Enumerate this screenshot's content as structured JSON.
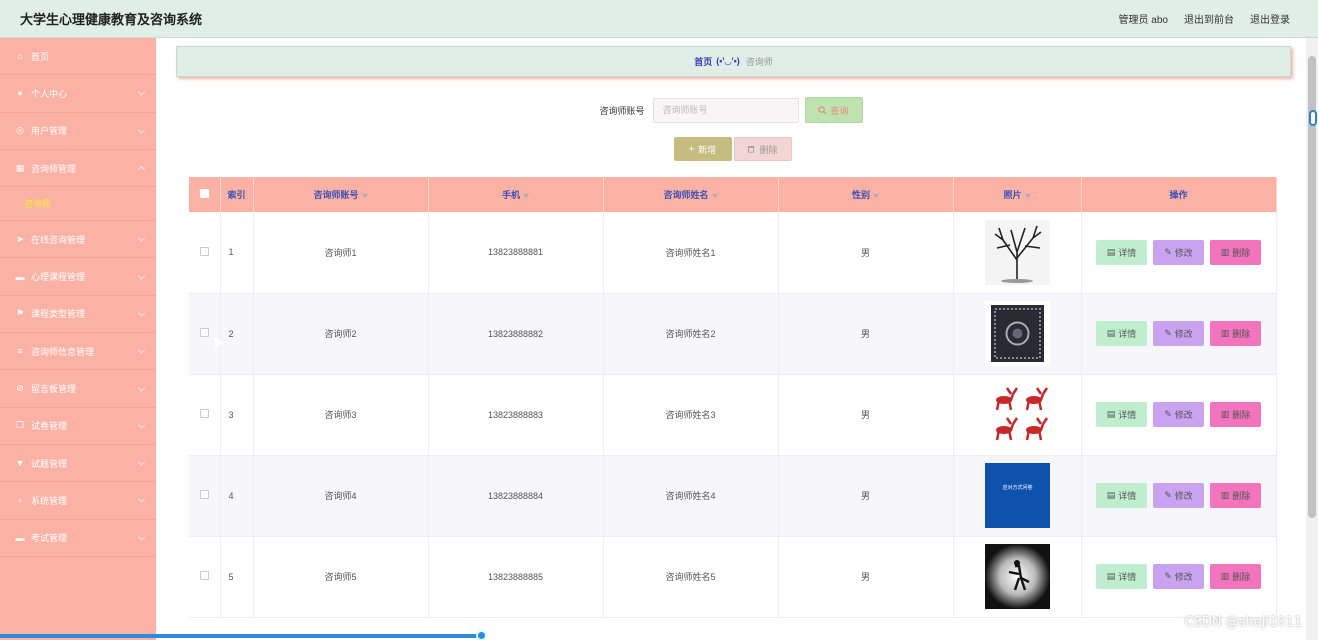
{
  "app": {
    "title": "大学生心理健康教育及咨询系统",
    "top_actions": [
      "管理员 abo",
      "退出到前台",
      "退出登录"
    ]
  },
  "sidebar": {
    "items": [
      {
        "label": "首页",
        "icon": "home-icon",
        "expandable": false
      },
      {
        "label": "个人中心",
        "icon": "user-icon",
        "expandable": true
      },
      {
        "label": "用户管理",
        "icon": "globe-icon",
        "expandable": true
      },
      {
        "label": "咨询师管理",
        "icon": "grid-icon",
        "expandable": true,
        "expanded": true
      },
      {
        "label": "在线咨询管理",
        "icon": "send-icon",
        "expandable": true
      },
      {
        "label": "心理课程管理",
        "icon": "truck-icon",
        "expandable": true
      },
      {
        "label": "课程类型管理",
        "icon": "flag-icon",
        "expandable": true
      },
      {
        "label": "咨询师信息管理",
        "icon": "menu-icon",
        "expandable": true
      },
      {
        "label": "留言板管理",
        "icon": "compass-icon",
        "expandable": true
      },
      {
        "label": "试卷管理",
        "icon": "copy-icon",
        "expandable": true
      },
      {
        "label": "试题管理",
        "icon": "trophy-icon",
        "expandable": true
      },
      {
        "label": "系统管理",
        "icon": "mic-icon",
        "expandable": true
      },
      {
        "label": "考试管理",
        "icon": "chat-icon",
        "expandable": true
      }
    ],
    "active_submenu": "咨询师"
  },
  "breadcrumb": {
    "home": "首页",
    "face": "(•'◡'•)",
    "current": "咨询师"
  },
  "search": {
    "label": "咨询师账号",
    "placeholder": "咨询师账号",
    "button": "查询"
  },
  "actions": {
    "add": "新增",
    "delete": "删除"
  },
  "table": {
    "columns": [
      "",
      "索引",
      "咨询师账号",
      "手机",
      "咨询师姓名",
      "性别",
      "照片",
      "操作"
    ],
    "rows": [
      {
        "index": "1",
        "account": "咨询师1",
        "phone": "13823888881",
        "name": "咨询师姓名1",
        "gender": "男",
        "photo": "tree"
      },
      {
        "index": "2",
        "account": "咨询师2",
        "phone": "13823888882",
        "name": "咨询师姓名2",
        "gender": "男",
        "photo": "rug"
      },
      {
        "index": "3",
        "account": "咨询师3",
        "phone": "13823888883",
        "name": "咨询师姓名3",
        "gender": "男",
        "photo": "deer"
      },
      {
        "index": "4",
        "account": "咨询师4",
        "phone": "13823888884",
        "name": "咨询师姓名4",
        "gender": "男",
        "photo": "blue",
        "photo_text": "应对方式问卷"
      },
      {
        "index": "5",
        "account": "咨询师5",
        "phone": "13823888885",
        "name": "咨询师姓名5",
        "gender": "男",
        "photo": "silhouette"
      }
    ],
    "row_buttons": {
      "detail": "详情",
      "edit": "修改",
      "delete": "删除"
    }
  },
  "watermark": "CSDN @sheji1011",
  "colors": {
    "sidebar": "#fbb2a4",
    "header": "#dfeee6",
    "accent_text": "#3f51b5",
    "detail_btn": "#bfeecf",
    "edit_btn": "#c9a3f0",
    "delete_btn": "#f174bd"
  }
}
